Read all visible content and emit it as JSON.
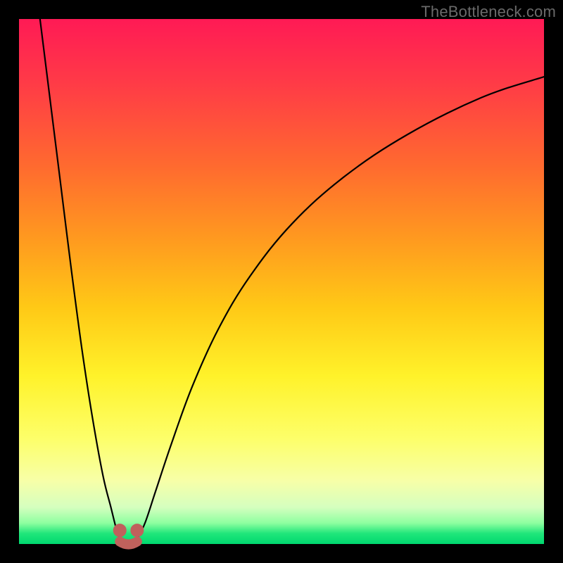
{
  "watermark_text": "TheBottleneck.com",
  "chart_data": {
    "type": "line",
    "title": "",
    "xlabel": "",
    "ylabel": "",
    "xlim": [
      0,
      100
    ],
    "ylim": [
      0,
      100
    ],
    "series": [
      {
        "name": "left-branch",
        "x": [
          4,
          6,
          8,
          10,
          12,
          14,
          16,
          17.5,
          18.5,
          19.2
        ],
        "y": [
          100,
          84,
          68,
          52,
          37,
          24,
          13,
          7,
          3,
          1
        ]
      },
      {
        "name": "right-branch",
        "x": [
          22.5,
          24,
          26,
          29,
          33,
          38,
          44,
          52,
          62,
          74,
          88,
          100
        ],
        "y": [
          1,
          4,
          10,
          19,
          30,
          41,
          51,
          61,
          70,
          78,
          85,
          89
        ]
      }
    ],
    "markers": [
      {
        "name": "valley-left-dot",
        "x": 19.2,
        "y": 2.6
      },
      {
        "name": "valley-right-dot",
        "x": 22.5,
        "y": 2.6
      }
    ],
    "valley_bridge": {
      "x1": 19.2,
      "x2": 22.5,
      "y": 1.0
    },
    "background_gradient": {
      "top": "#ff1a55",
      "mid": "#fff22a",
      "bottom": "#00d86f"
    }
  }
}
